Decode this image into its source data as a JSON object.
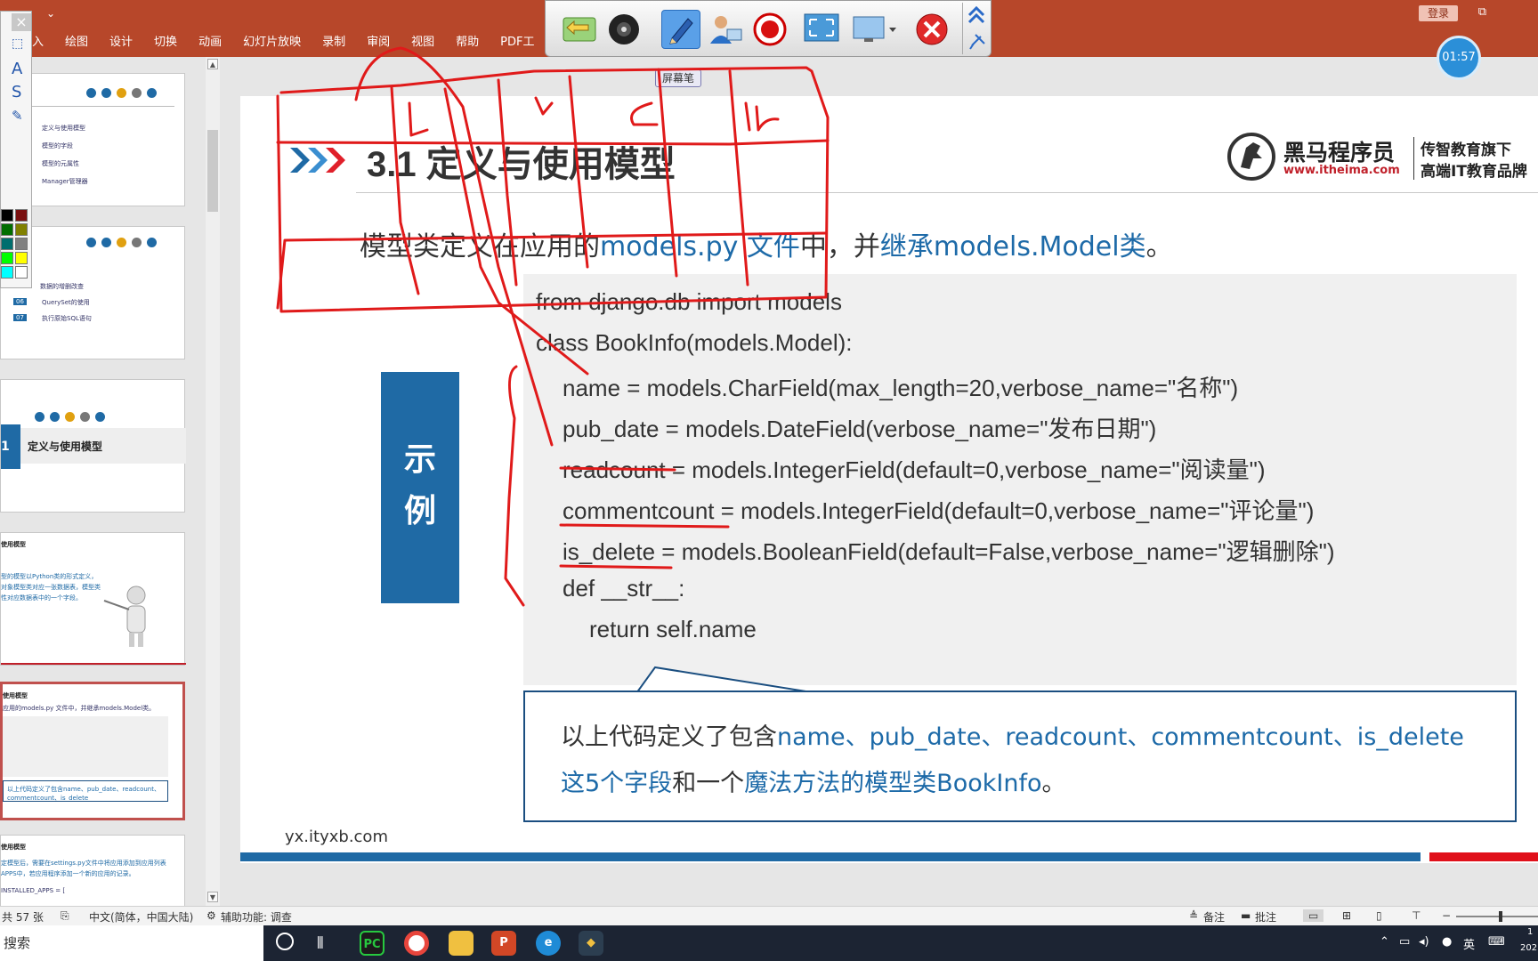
{
  "ribbon": {
    "qat_label": "⌄",
    "tabs": [
      "入",
      "绘图",
      "设计",
      "切换",
      "动画",
      "幻灯片放映",
      "录制",
      "审阅",
      "视图",
      "帮助",
      "PDF工"
    ],
    "login": "登录",
    "timer": "01:57"
  },
  "pen_toolbar": {
    "tools": [
      "return-icon",
      "record-disc-icon",
      "pen-icon",
      "user-icon",
      "record-icon",
      "fullscreen-icon",
      "screen-icon",
      "close-icon"
    ],
    "label": "屏幕笔"
  },
  "palette": {
    "close": "×",
    "colors": [
      "#000000",
      "#7a1010",
      "#006e00",
      "#808000",
      "#006e6e",
      "#808080",
      "#00ff00",
      "#ffff00",
      "#00ffff",
      "#ffffff"
    ]
  },
  "thumbnails": {
    "t1": [
      "定义与使用模型",
      "模型的字段",
      "模型的元属性",
      "Manager管理器"
    ],
    "t2_nums": [
      "06",
      "07"
    ],
    "t2": [
      "数据的增删改查",
      "QuerySet的使用",
      "执行原始SQL语句"
    ],
    "t3_num": "1",
    "t3": "定义与使用模型",
    "t4_title": "使用模型",
    "t4_text": [
      "型的模型以Python类的形式定义，",
      "对象模型类对应一张数据表，模型类",
      "性对应数据表中的一个字段。"
    ],
    "t5_title": "使用模型",
    "t5_text": "应用的models.py 文件中，并继承models.Model类。",
    "t5_callout": "以上代码定义了包含name、pub_date、readcount、commentcount、is_delete",
    "t6_title": "使用模型",
    "t6_text": [
      "定模型后，需要在settings.py文件中将应用添加到应用列表",
      "APPS中，若应用程序添加一个新的应用的记录。",
      "INSTALLED_APPS = ["
    ]
  },
  "slide": {
    "title": "3.1  定义与使用模型",
    "brand_name": "黑马程序员",
    "brand_url": "www.itheima.com",
    "brand_sub1": "传智教育旗下",
    "brand_sub2": "高端IT教育品牌",
    "intro_a": "模型类定义在应用的",
    "intro_b": "models.py 文件",
    "intro_c": "中，并",
    "intro_d": "继承models.Model类",
    "intro_e": "。",
    "example_1": "示",
    "example_2": "例",
    "code": [
      "from django.db import models",
      "class BookInfo(models.Model):",
      "    name = models.CharField(max_length=20,verbose_name=\"名称\")",
      "    pub_date = models.DateField(verbose_name=\"发布日期\")",
      "    readcount = models.IntegerField(default=0,verbose_name=\"阅读量\")",
      "    commentcount = models.IntegerField(default=0,verbose_name=\"评论量\")",
      "    is_delete = models.BooleanField(default=False,verbose_name=\"逻辑删除\")",
      "    def __str__:",
      "        return self.name"
    ],
    "callout_a": "以上代码定义了包含",
    "callout_b": "name、pub_date、readcount、commentcount、is_delete",
    "callout_c": "这5个字段",
    "callout_d": "和一个",
    "callout_e": "魔法方法的模型类BookInfo",
    "callout_f": "。",
    "footer_url": "yx.ityxb.com"
  },
  "status": {
    "slides": "共 57 张",
    "lang": "中文(简体，中国大陆)",
    "access": "辅助功能: 调查",
    "notes": "备注",
    "comments": "批注"
  },
  "taskbar": {
    "search": "搜索",
    "apps": [
      "pycharm",
      "chrome",
      "explorer",
      "powerpoint",
      "edge",
      "git"
    ],
    "ime": "英",
    "clock_1": "1",
    "clock_2": "202"
  }
}
